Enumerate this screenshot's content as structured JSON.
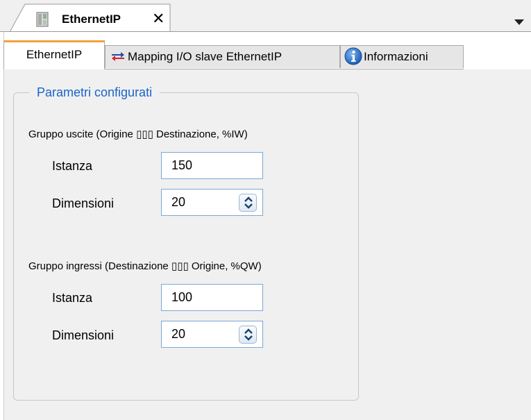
{
  "document_tab": {
    "title": "EthernetIP",
    "close_glyph": "✕",
    "icon": "device-module-icon"
  },
  "tabs": [
    {
      "label": "EthernetIP",
      "icon": "",
      "active": true
    },
    {
      "label": "Mapping I/O slave EthernetIP",
      "icon": "swap-arrows-icon",
      "active": false
    },
    {
      "label": "Informazioni",
      "icon": "info-icon",
      "active": false
    }
  ],
  "group": {
    "title": "Parametri configurati",
    "output_group": {
      "label": "Gruppo uscite (Origine ▯▯▯ Destinazione, %IW)",
      "instance_label": "Istanza",
      "instance_value": "150",
      "size_label": "Dimensioni",
      "size_value": "20"
    },
    "input_group": {
      "label": "Gruppo ingressi (Destinazione ▯▯▯ Origine, %QW)",
      "instance_label": "Istanza",
      "instance_value": "100",
      "size_label": "Dimensioni",
      "size_value": "20"
    }
  },
  "colors": {
    "active_tab_accent": "#f2a23a",
    "legend_text": "#1a64c8",
    "swap_red": "#d3232f",
    "swap_blue": "#1f4fa8",
    "info_blue": "#1b6fd1"
  }
}
